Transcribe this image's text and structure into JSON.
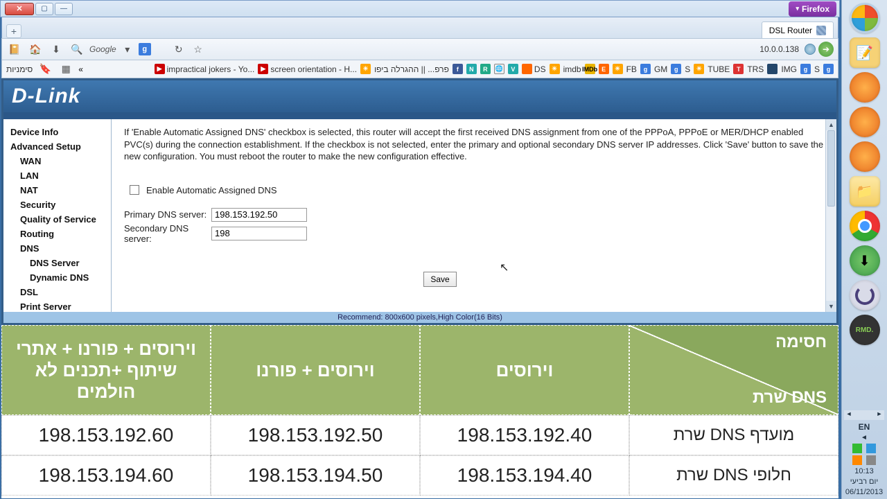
{
  "window": {
    "close": "✕",
    "max": "▢",
    "min": "—"
  },
  "firefox_badge": "Firefox",
  "tab": {
    "title": "DSL Router"
  },
  "nav": {
    "search_provider": "Google",
    "url": "10.0.0.138"
  },
  "bookmarks_label": "סימניות",
  "bookmarks": [
    {
      "icon": "yt",
      "iconClass": "b-yt",
      "iconText": "▶",
      "label": "impractical jokers - Yo..."
    },
    {
      "icon": "yt",
      "iconClass": "b-yt",
      "iconText": "▶",
      "label": "screen orientation - H..."
    },
    {
      "icon": "draw",
      "iconClass": "b-sun",
      "iconText": "☀",
      "label": ""
    },
    {
      "icon": "txt",
      "iconClass": "",
      "iconText": "",
      "label": "פרפ... || ההגרלה ביפו"
    },
    {
      "icon": "fb",
      "iconClass": "b-blue",
      "iconText": "f",
      "label": ""
    },
    {
      "icon": "n",
      "iconClass": "b-teal",
      "iconText": "N",
      "label": ""
    },
    {
      "icon": "r",
      "iconClass": "b-green",
      "iconText": "R",
      "label": ""
    },
    {
      "icon": "globe",
      "iconClass": "b-wiki",
      "iconText": "🌐",
      "label": ""
    },
    {
      "icon": "v",
      "iconClass": "b-teal",
      "iconText": "V",
      "label": ""
    },
    {
      "icon": "ds",
      "iconClass": "b-orange",
      "iconText": "",
      "label": "DS"
    },
    {
      "icon": "sun",
      "iconClass": "b-sun",
      "iconText": "☀",
      "label": ""
    },
    {
      "icon": "imdb",
      "iconClass": "",
      "iconText": "",
      "label": "imdb"
    },
    {
      "icon": "imdb2",
      "iconClass": "b-gold",
      "iconText": "IMDb",
      "label": ""
    },
    {
      "icon": "e",
      "iconClass": "b-orange",
      "iconText": "E",
      "label": ""
    },
    {
      "icon": "sun2",
      "iconClass": "b-sun",
      "iconText": "☀",
      "label": ""
    },
    {
      "icon": "fb2",
      "iconClass": "",
      "iconText": "",
      "label": "FB"
    },
    {
      "icon": "g1",
      "iconClass": "b-gg",
      "iconText": "g",
      "label": ""
    },
    {
      "icon": "gm",
      "iconClass": "",
      "iconText": "",
      "label": "GM"
    },
    {
      "icon": "g2",
      "iconClass": "b-gg",
      "iconText": "g",
      "label": ""
    },
    {
      "icon": "s1",
      "iconClass": "",
      "iconText": "",
      "label": "S"
    },
    {
      "icon": "sun3",
      "iconClass": "b-sun",
      "iconText": "☀",
      "label": ""
    },
    {
      "icon": "tube",
      "iconClass": "",
      "iconText": "",
      "label": "TUBE"
    },
    {
      "icon": "tr",
      "iconClass": "b-red",
      "iconText": "T",
      "label": ""
    },
    {
      "icon": "trs",
      "iconClass": "",
      "iconText": "",
      "label": "TRS"
    },
    {
      "icon": "img1",
      "iconClass": "b-navy",
      "iconText": "",
      "label": ""
    },
    {
      "icon": "img",
      "iconClass": "",
      "iconText": "",
      "label": "IMG"
    },
    {
      "icon": "g3",
      "iconClass": "b-gg",
      "iconText": "g",
      "label": ""
    },
    {
      "icon": "s2",
      "iconClass": "",
      "iconText": "",
      "label": "S"
    },
    {
      "icon": "g4",
      "iconClass": "b-gg",
      "iconText": "g",
      "label": ""
    }
  ],
  "router": {
    "logo": "D-Link",
    "side": {
      "device_info": "Device Info",
      "advanced": "Advanced Setup",
      "wan": "WAN",
      "lan": "LAN",
      "nat": "NAT",
      "security": "Security",
      "qos": "Quality of Service",
      "routing": "Routing",
      "dns": "DNS",
      "dns_server": "DNS Server",
      "ddns": "Dynamic DNS",
      "dsl": "DSL",
      "print": "Print Server"
    },
    "description": "If 'Enable Automatic Assigned DNS' checkbox is selected, this router will accept the first received DNS assignment from one of the PPPoA, PPPoE or MER/DHCP enabled PVC(s) during the connection establishment. If the checkbox is not selected, enter the primary and optional secondary DNS server IP addresses. Click 'Save' button to save the new configuration. You must reboot the router to make the new configuration effective.",
    "auto_dns": "Enable Automatic Assigned DNS",
    "primary_label": "Primary DNS server:",
    "primary_value": "198.153.192.50",
    "secondary_label": "Secondary DNS server:",
    "secondary_value": "198",
    "save": "Save",
    "footer": "Recommend: 800x600 pixels,High Color(16 Bits)"
  },
  "dns_table": {
    "headers": {
      "col1": "וירוסים + פורנו + אתרי שיתוף +תכנים לא הולמים",
      "col2": "וירוסים + פורנו",
      "col3": "וירוסים",
      "diag_top": "חסימה",
      "diag_bot": "שרת DNS"
    },
    "rows": [
      {
        "c1": "198.153.192.60",
        "c2": "198.153.192.50",
        "c3": "198.153.192.40",
        "label": "שרת DNS מועדף"
      },
      {
        "c1": "198.153.194.60",
        "c2": "198.153.194.50",
        "c3": "198.153.194.40",
        "label": "שרת DNS חלופי"
      }
    ]
  },
  "tray": {
    "lang": "EN",
    "time": "10:13",
    "day": "יום רביעי",
    "date": "06/11/2013"
  }
}
